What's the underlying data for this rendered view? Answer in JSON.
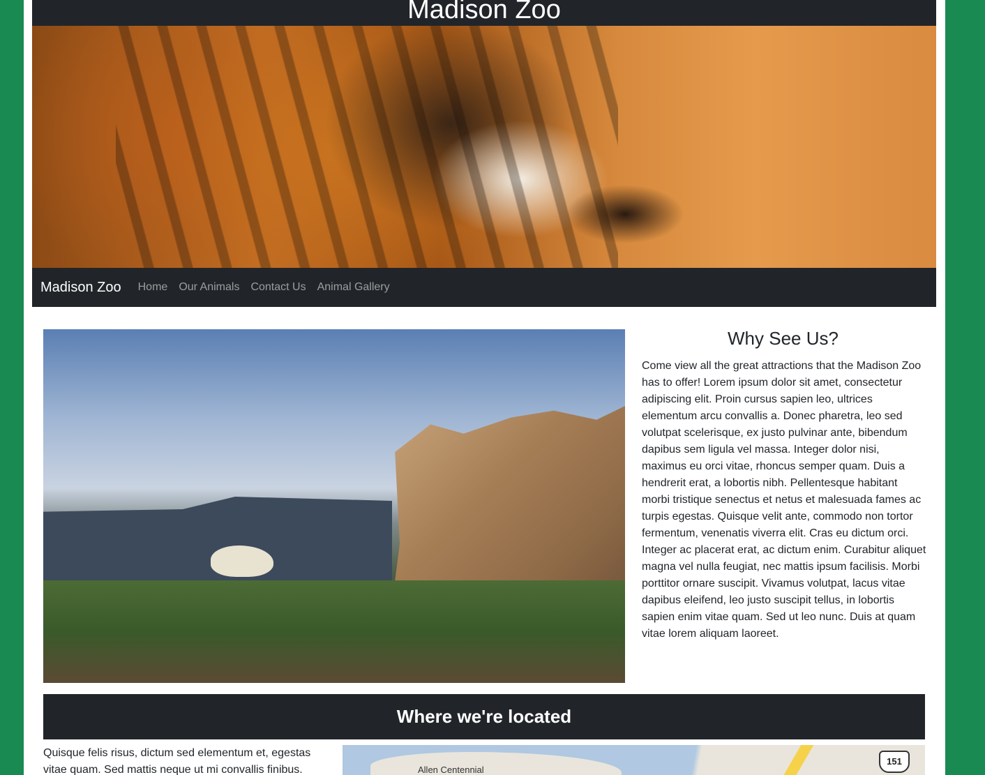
{
  "header": {
    "title": "Madison Zoo"
  },
  "nav": {
    "brand": "Madison Zoo",
    "links": [
      "Home",
      "Our Animals",
      "Contact Us",
      "Animal Gallery"
    ]
  },
  "why": {
    "title": "Why See Us?",
    "body": "Come view all the great attractions that the Madison Zoo has to offer! Lorem ipsum dolor sit amet, consectetur adipiscing elit. Proin cursus sapien leo, ultrices elementum arcu convallis a. Donec pharetra, leo sed volutpat scelerisque, ex justo pulvinar ante, bibendum dapibus sem ligula vel massa. Integer dolor nisi, maximus eu orci vitae, rhoncus semper quam. Duis a hendrerit erat, a lobortis nibh. Pellentesque habitant morbi tristique senectus et netus et malesuada fames ac turpis egestas. Quisque velit ante, commodo non tortor fermentum, venenatis viverra elit. Cras eu dictum orci. Integer ac placerat erat, ac dictum enim. Curabitur aliquet magna vel nulla feugiat, nec mattis ipsum facilisis. Morbi porttitor ornare suscipit. Vivamus volutpat, lacus vitae dapibus eleifend, leo justo suscipit tellus, in lobortis sapien enim vitae quam. Sed ut leo nunc. Duis at quam vitae lorem aliquam laoreet."
  },
  "location": {
    "title": "Where we're located",
    "text": "Quisque felis risus, dictum sed elementum et, egestas vitae quam. Sed mattis neque ut mi convallis finibus.",
    "map_label": "Allen Centennial",
    "map_shield": "151"
  },
  "colors": {
    "page_background": "#198a52",
    "dark_bar": "#212529"
  }
}
